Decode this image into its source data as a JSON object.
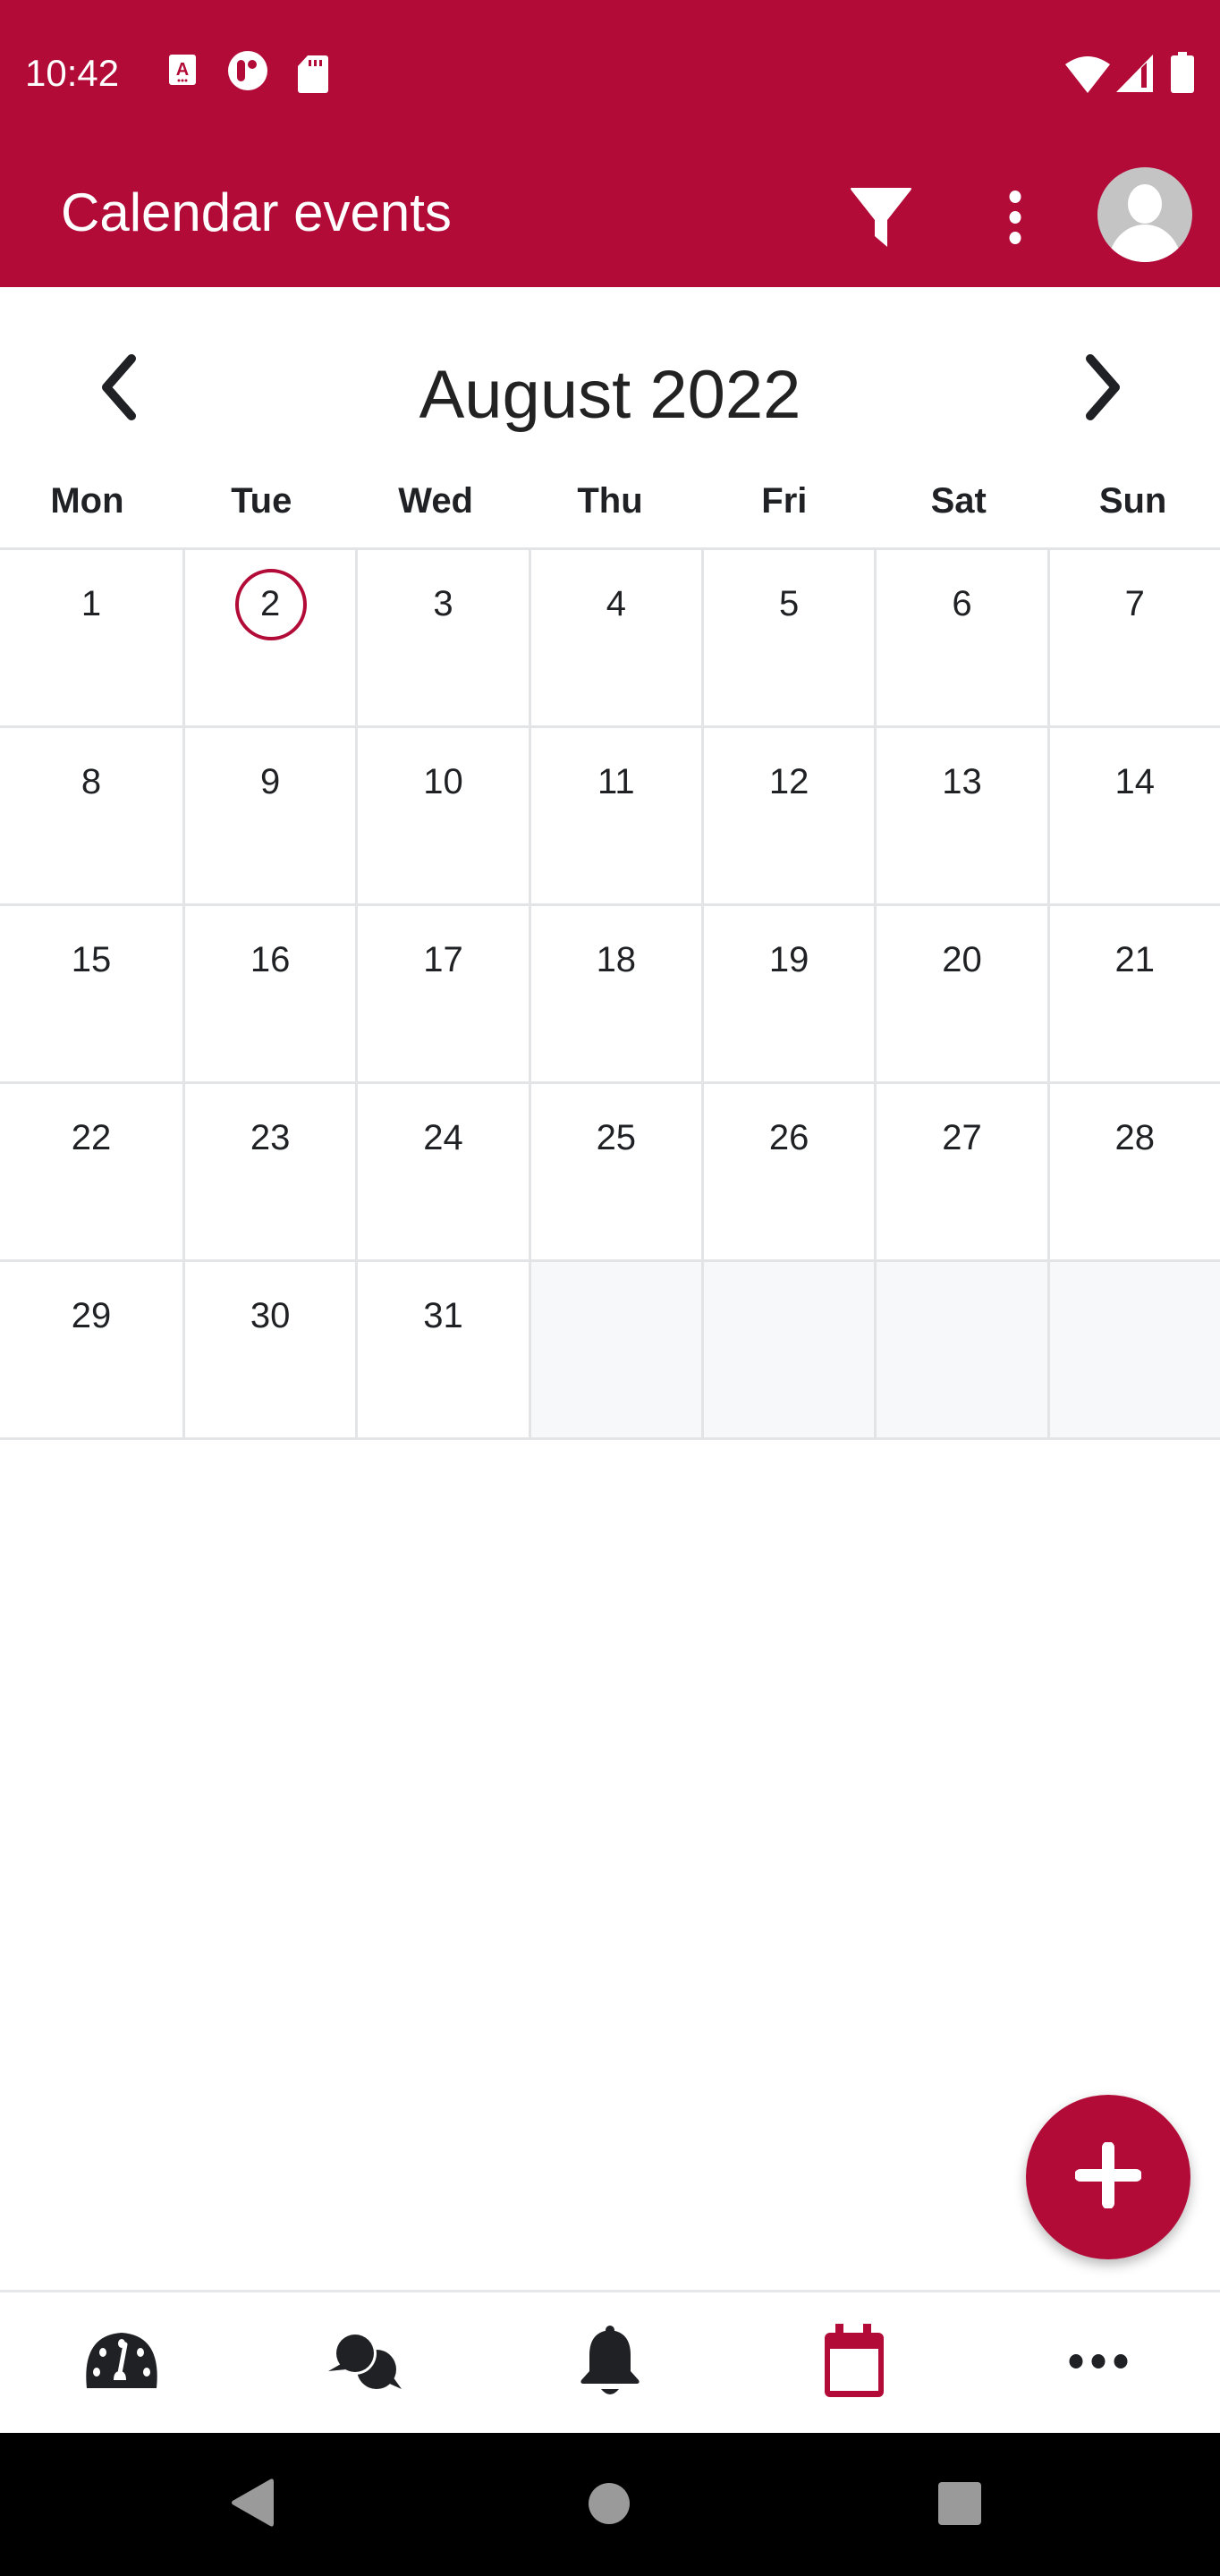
{
  "status_bar": {
    "time": "10:42",
    "left_icons": [
      "accessibility-a-icon",
      "app-notification-icon",
      "sd-card-icon"
    ],
    "right_icons": [
      "wifi-icon",
      "cell-signal-icon",
      "battery-icon"
    ]
  },
  "app_bar": {
    "title": "Calendar events",
    "actions": [
      "filter-icon",
      "more-vertical-icon",
      "avatar"
    ]
  },
  "calendar": {
    "month_label": "August 2022",
    "prev_label": "Previous month",
    "next_label": "Next month",
    "weekdays": [
      "Mon",
      "Tue",
      "Wed",
      "Thu",
      "Fri",
      "Sat",
      "Sun"
    ],
    "today": 2,
    "weeks": [
      [
        "1",
        "2",
        "3",
        "4",
        "5",
        "6",
        "7"
      ],
      [
        "8",
        "9",
        "10",
        "11",
        "12",
        "13",
        "14"
      ],
      [
        "15",
        "16",
        "17",
        "18",
        "19",
        "20",
        "21"
      ],
      [
        "22",
        "23",
        "24",
        "25",
        "26",
        "27",
        "28"
      ],
      [
        "29",
        "30",
        "31",
        "",
        "",
        "",
        ""
      ]
    ]
  },
  "fab": {
    "icon": "plus-icon",
    "label": "Add event"
  },
  "bottom_nav": {
    "items": [
      {
        "icon": "dashboard-gauge-icon",
        "active": false
      },
      {
        "icon": "chat-bubbles-icon",
        "active": false
      },
      {
        "icon": "bell-icon",
        "active": false
      },
      {
        "icon": "calendar-icon",
        "active": true
      },
      {
        "icon": "more-horizontal-icon",
        "active": false
      }
    ]
  },
  "colors": {
    "primary": "#b20b37",
    "text": "#1f2124",
    "grid_line": "#e3e4e6",
    "empty_cell": "#f7f8fa",
    "avatar_bg": "#c4c4c4"
  }
}
